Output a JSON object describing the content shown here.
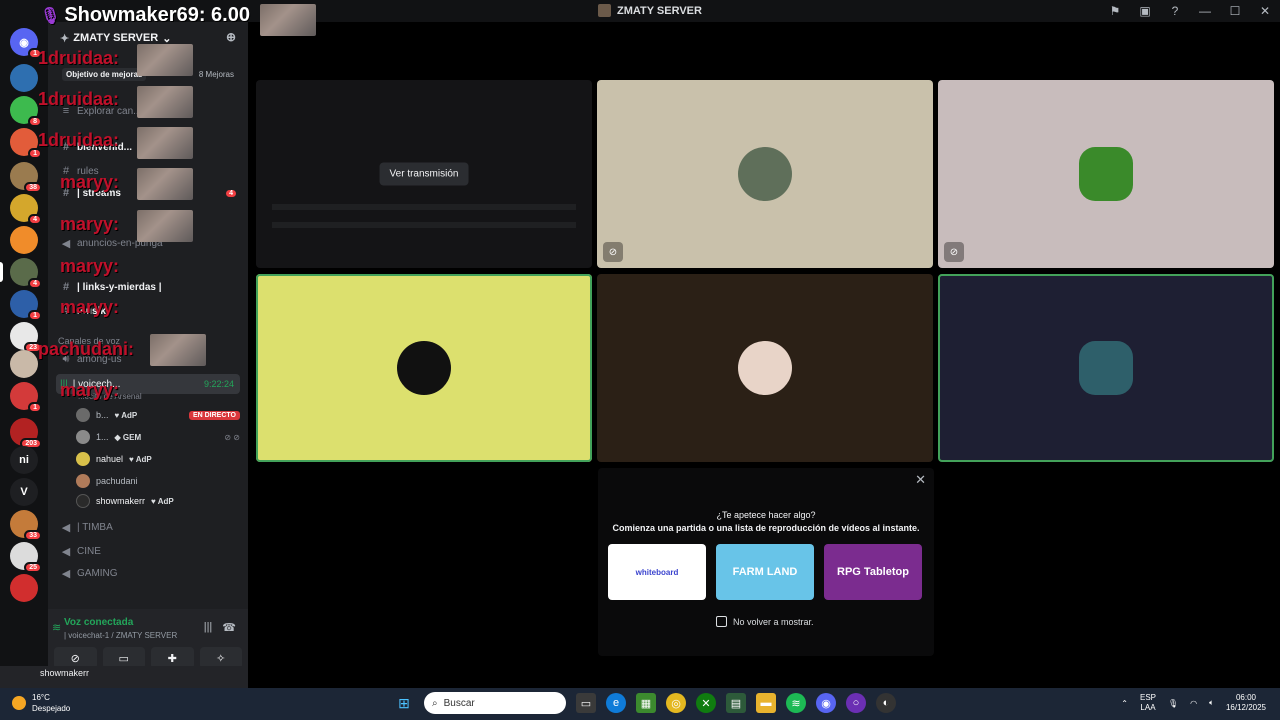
{
  "window": {
    "title": "ZMATY SERVER"
  },
  "overlay": {
    "top_label": "Showmaker69: 6.00",
    "names": [
      {
        "name": "1druidaa:"
      },
      {
        "name": "1druidaa:"
      },
      {
        "name": "1druidaa:"
      },
      {
        "name": "maryy:"
      },
      {
        "name": "maryy:"
      },
      {
        "name": "maryy:"
      },
      {
        "name": "maryy:"
      },
      {
        "name": "pachudani:"
      },
      {
        "name": "maryy:"
      }
    ]
  },
  "server_rail": {
    "badges": [
      "1",
      "8",
      "1",
      "38",
      "4",
      "4",
      "1",
      "23",
      "1",
      "203",
      "33",
      "25"
    ],
    "text_servers": [
      "ni",
      "V"
    ]
  },
  "sidebar": {
    "server_name": "ZMATY SERVER",
    "boost_goal": "Objetivo de mejoras",
    "boost_count": "8 Mejoras",
    "browse_channels": "Explorar can...",
    "channels": [
      {
        "name": "bienvenid...",
        "glyph": "#"
      },
      {
        "name": "rules",
        "glyph": "#"
      },
      {
        "name": "| streams",
        "glyph": "#",
        "mention": "4"
      },
      {
        "name": "anuncios-en-punga",
        "glyph": "#"
      },
      {
        "name": "| links-y-mierdas |",
        "glyph": "#"
      },
      {
        "name": "musik",
        "glyph": "#"
      }
    ],
    "voice_category": "Canales de voz",
    "voice_channels": [
      {
        "name": "among-us"
      }
    ],
    "active_voice": {
      "name": "| voicech...",
      "time": "9:22:24",
      "sub": "...ecito de Arsenal"
    },
    "users": [
      {
        "name": "b...",
        "tag": "AdP",
        "live": "EN DIRECTO",
        "color": "#6a6a6a"
      },
      {
        "name": "1...",
        "tag": "GEM",
        "color": "#8a8a8a"
      },
      {
        "name": "nahuel",
        "tag": "AdP",
        "color": "#d8c04a"
      },
      {
        "name": "pachudani",
        "tag": "",
        "color": "#b07b5a"
      },
      {
        "name": "showmakerr",
        "tag": "AdP",
        "color": "#2a2a2a"
      }
    ],
    "more_voice": [
      {
        "name": "| TIMBA"
      },
      {
        "name": "CINE"
      },
      {
        "name": "GAMING"
      }
    ]
  },
  "voice_panel": {
    "status": "Voz conectada",
    "path": "| voicechat-1 / ZMATY SERVER"
  },
  "user_bar": {
    "name": "showmakerr"
  },
  "stage": {
    "stream_button": "Ver transmisión"
  },
  "activity": {
    "question": "¿Te apetece hacer algo?",
    "description": "Comienza una partida o una lista de reproducción de vídeos al instante.",
    "items": [
      {
        "label": "whiteboard"
      },
      {
        "label": "FARM LAND"
      },
      {
        "label": "RPG Tabletop"
      }
    ],
    "checkbox_label": "No volver a mostrar."
  },
  "taskbar": {
    "temp": "16°C",
    "weather": "Despejado",
    "search_placeholder": "Buscar",
    "lang_1": "ESP",
    "lang_2": "LAA",
    "time": "06:00",
    "date": "16/12/2025"
  },
  "colors": {
    "accent_green": "#23a55a",
    "mention_red": "#f23f43",
    "overlay_red": "#c0102a"
  }
}
